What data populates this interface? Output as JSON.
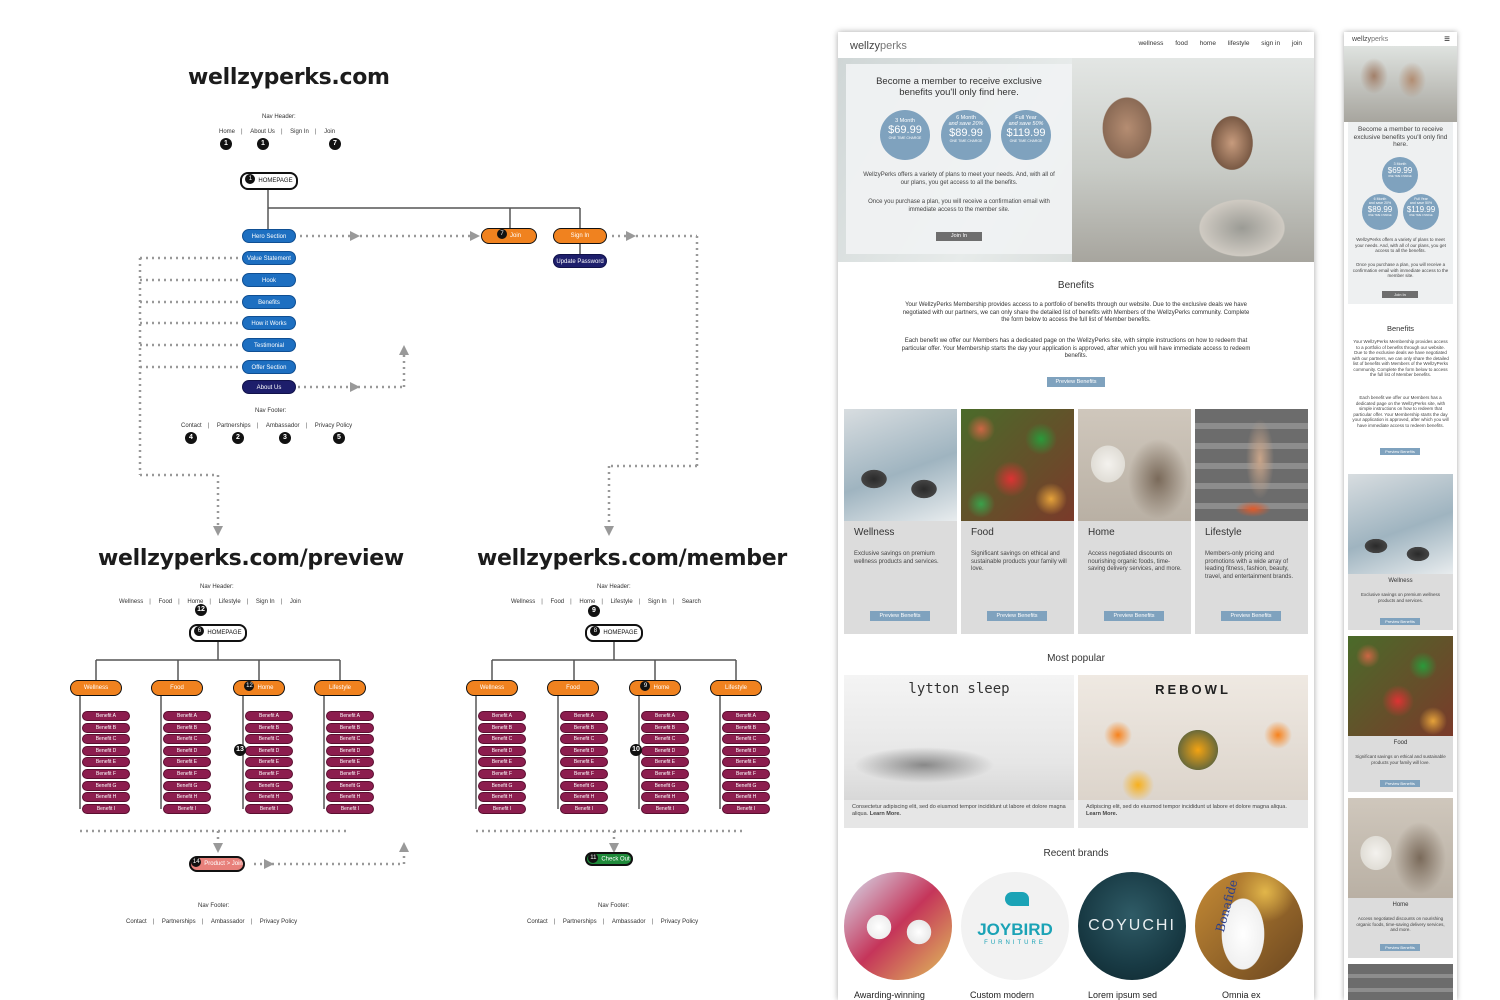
{
  "sitemap": {
    "home": {
      "title": "wellzyperks.com",
      "nav_caption": "Nav Header:",
      "nav": [
        {
          "label": "Home",
          "num": "1"
        },
        {
          "label": "About Us",
          "num": "1"
        },
        {
          "label": "Sign In",
          "num": ""
        },
        {
          "label": "Join",
          "num": "7"
        }
      ],
      "root": {
        "num": "1",
        "label": "HOMEPAGE"
      },
      "sections": [
        "Hero Section",
        "Value Statement",
        "Hook",
        "Benefits",
        "How it Works",
        "Testimonial",
        "Offer Section",
        "About Us"
      ],
      "join": {
        "num": "7",
        "label": "Join"
      },
      "signin": "Sign In",
      "update_password": "Update Password",
      "footer_caption": "Nav Footer:",
      "footer": [
        {
          "label": "Contact",
          "num": "4"
        },
        {
          "label": "Partnerships",
          "num": "2"
        },
        {
          "label": "Ambassador",
          "num": "3"
        },
        {
          "label": "Privacy Policy",
          "num": "5"
        }
      ]
    },
    "preview": {
      "title": "wellzyperks.com/preview",
      "nav_caption": "Nav Header:",
      "nav": [
        "Wellness",
        "Food",
        "Home",
        "Lifestyle",
        "Sign In",
        "Join"
      ],
      "nav_num": "12",
      "root": {
        "num": "6",
        "label": "HOMEPAGE"
      },
      "categories": [
        "Wellness",
        "Food",
        "Home",
        "Lifestyle"
      ],
      "home_num": "12",
      "benefit_num": "13",
      "benefits": [
        "Benefit A",
        "Benefit B",
        "Benefit C",
        "Benefit D",
        "Benefit E",
        "Benefit F",
        "Benefit G",
        "Benefit H",
        "Benefit I"
      ],
      "product": {
        "num": "14",
        "label": "Product > Join"
      },
      "footer_caption": "Nav Footer:",
      "footer": [
        "Contact",
        "Partnerships",
        "Ambassador",
        "Privacy Policy"
      ]
    },
    "member": {
      "title": "wellzyperks.com/member",
      "nav_caption": "Nav Header:",
      "nav": [
        "Wellness",
        "Food",
        "Home",
        "Lifestyle",
        "Sign In",
        "Search"
      ],
      "nav_num": "9",
      "root": {
        "num": "8",
        "label": "HOMEPAGE"
      },
      "categories": [
        "Wellness",
        "Food",
        "Home",
        "Lifestyle"
      ],
      "home_num": "9",
      "benefit_num": "10",
      "benefits": [
        "Benefit A",
        "Benefit B",
        "Benefit C",
        "Benefit D",
        "Benefit E",
        "Benefit F",
        "Benefit G",
        "Benefit H",
        "Benefit I"
      ],
      "checkout": {
        "num": "11",
        "label": "Check Out"
      },
      "footer_caption": "Nav Footer:",
      "footer": [
        "Contact",
        "Partnerships",
        "Ambassador",
        "Privacy Policy"
      ]
    },
    "colors": {
      "blue": "#1d6fc1",
      "navy": "#1d1e6b",
      "orange": "#f0821f",
      "benefit": "#8c1d4e",
      "pink": "#e8807a",
      "green": "#1f8a3a"
    }
  },
  "desktop": {
    "logo_a": "wellzy",
    "logo_b": "perks",
    "nav": [
      "wellness",
      "food",
      "home",
      "lifestyle",
      "sign in",
      "join"
    ],
    "hero_heading": "Become a member to receive exclusive benefits you'll only find here.",
    "plans": [
      {
        "label": "3 Month",
        "sub": "",
        "price": "$69.99",
        "note": "ONE TIME CHARGE"
      },
      {
        "label": "6 Month",
        "sub": "and save 20%",
        "price": "$89.99",
        "note": "ONE TIME CHARGE"
      },
      {
        "label": "Full Year",
        "sub": "and save 50%",
        "price": "$119.99",
        "note": "ONE TIME CHARGE"
      }
    ],
    "hero_text_1": "WellzyPerks offers a variety of plans to meet your needs. And, with all of our plans, you get access to all the benefits.",
    "hero_text_2": "Once you purchase a plan, you will receive a confirmation email with immediate access to the member site.",
    "join_btn": "Join In",
    "benefits_title": "Benefits",
    "benefits_p1": "Your WellzyPerks Membership provides access to a portfolio of benefits through our website. Due to the exclusive deals we have negotiated with our partners, we can only share the detailed list of benefits with Members of the WellzyPerks community. Complete the form below to access the full list of Member benefits.",
    "benefits_p2": "Each benefit we offer our Members has a dedicated page on the WellzyPerks site, with simple instructions on how to redeem that particular offer. Your Membership starts the day your application is approved, after which you will have immediate access to redeem benefits.",
    "preview_btn": "Preview Benefits",
    "cards": [
      {
        "title": "Wellness",
        "desc": "Exclusive savings on premium wellness products and services."
      },
      {
        "title": "Food",
        "desc": "Significant savings on ethical and sustainable products your family will love."
      },
      {
        "title": "Home",
        "desc": "Access negotiated discounts on nourishing organic foods, time-saving delivery services, and more."
      },
      {
        "title": "Lifestyle",
        "desc": "Members-only pricing and promotions with a wide array of leading fitness, fashion, beauty, travel, and entertainment brands."
      }
    ],
    "popular_title": "Most popular",
    "popular": [
      {
        "brand": "lytton sleep",
        "text": "Consectetur adipiscing elit, sed do eiusmod tempor incididunt ut labore et dolore magna aliqua.",
        "more": "Learn More."
      },
      {
        "brand": "REBOWL",
        "text": "Adipiscing elit, sed do eiusmod tempor incididunt ut labore et dolore magna aliqua.",
        "more": "Learn More."
      }
    ],
    "recent_title": "Recent brands",
    "recent": [
      {
        "caption": "Awarding-winning",
        "logo": ""
      },
      {
        "caption": "Custom modern",
        "logo": "JOYBIRD",
        "logo_sub": "FURNITURE"
      },
      {
        "caption": "Lorem ipsum sed",
        "logo": "COYUCHI"
      },
      {
        "caption": "Omnia ex",
        "logo": "Bonafide"
      }
    ]
  },
  "mobile": {
    "logo_a": "wellzy",
    "logo_b": "perks",
    "menu_icon": "≡",
    "hero_heading": "Become a member to receive exclusive benefits you'll only find here.",
    "plans": [
      {
        "label": "3 Month",
        "sub": "",
        "price": "$69.99",
        "note": "ONE TIME CHARGE"
      },
      {
        "label": "6 Month",
        "sub": "and save 20%",
        "price": "$89.99",
        "note": "ONE TIME CHARGE"
      },
      {
        "label": "Full Year",
        "sub": "and save 50%",
        "price": "$119.99",
        "note": "ONE TIME CHARGE"
      }
    ],
    "hero_text_1": "WellzyPerks offers a variety of plans to meet your needs. And, with all of our plans, you get access to all the benefits.",
    "hero_text_2": "Once you purchase a plan, you will receive a confirmation email with immediate access to the member site.",
    "join_btn": "Join In",
    "benefits_title": "Benefits",
    "benefits_p1": "Your WellzyPerks Membership provides access to a portfolio of benefits through our website. Due to the exclusive deals we have negotiated with our partners, we can only share the detailed list of benefits with Members of the WellzyPerks community. Complete the form below to access the full list of Member benefits.",
    "benefits_p2": "Each benefit we offer our Members has a dedicated page on the WellzyPerks site, with simple instructions on how to redeem that particular offer. Your Membership starts the day your application is approved, after which you will have immediate access to redeem benefits.",
    "preview_btn": "Preview Benefits",
    "cards": [
      {
        "title": "Wellness",
        "desc": "Exclusive savings on premium wellness products and services."
      },
      {
        "title": "Food",
        "desc": "Significant savings on ethical and sustainable products your family will love."
      },
      {
        "title": "Home",
        "desc": "Access negotiated discounts on nourishing organic foods, time-saving delivery services, and more."
      }
    ]
  }
}
